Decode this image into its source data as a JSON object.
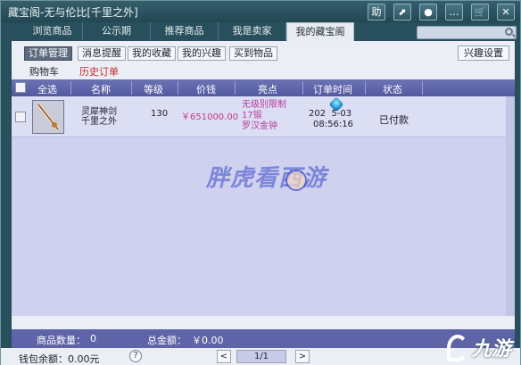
{
  "window": {
    "title": "藏宝阁-无与伦比[千里之外]"
  },
  "toolbar": {
    "buttons": [
      {
        "label": "助",
        "icon": "help-icon"
      },
      {
        "label": "⬈",
        "icon": "share-icon"
      },
      {
        "label": "●",
        "icon": "record-icon"
      },
      {
        "label": "…",
        "icon": "chat-icon"
      },
      {
        "label": "🛒",
        "icon": "cart-icon"
      },
      {
        "label": "✕",
        "icon": "close-icon"
      }
    ]
  },
  "tabs": [
    {
      "label": "浏览商品"
    },
    {
      "label": "公示期"
    },
    {
      "label": "推荐商品"
    },
    {
      "label": "我是卖家"
    },
    {
      "label": "我的藏宝阁"
    }
  ],
  "subtabs": [
    {
      "label": "订单管理"
    },
    {
      "label": "消息提醒"
    },
    {
      "label": "我的收藏"
    },
    {
      "label": "我的兴趣"
    },
    {
      "label": "买到物品"
    }
  ],
  "interest_button": "兴趣设置",
  "links": {
    "cart": "购物车",
    "history": "历史订单"
  },
  "table": {
    "headers": [
      "全选",
      "名称",
      "等级",
      "价钱",
      "亮点",
      "订单时间",
      "状态"
    ],
    "rows": [
      {
        "name_line1": "灵犀神剑",
        "name_line2": "千里之外",
        "level": "130",
        "price": "￥651000.00",
        "traits": [
          "无级别限制",
          "17锻",
          "罗汉金钟"
        ],
        "time_line1": "202  5-03",
        "time_line2": "08:56:16",
        "status": "已付款"
      }
    ]
  },
  "footer": {
    "count_label": "商品数量：",
    "count_value": "0",
    "total_label": "总金额：",
    "total_value": "￥0.00"
  },
  "bottom": {
    "wallet": "钱包余额：0.00元",
    "help": "?",
    "prev": "<",
    "next": ">",
    "page": "1/1"
  },
  "watermark": "胖虎看西游",
  "logo": "九游"
}
